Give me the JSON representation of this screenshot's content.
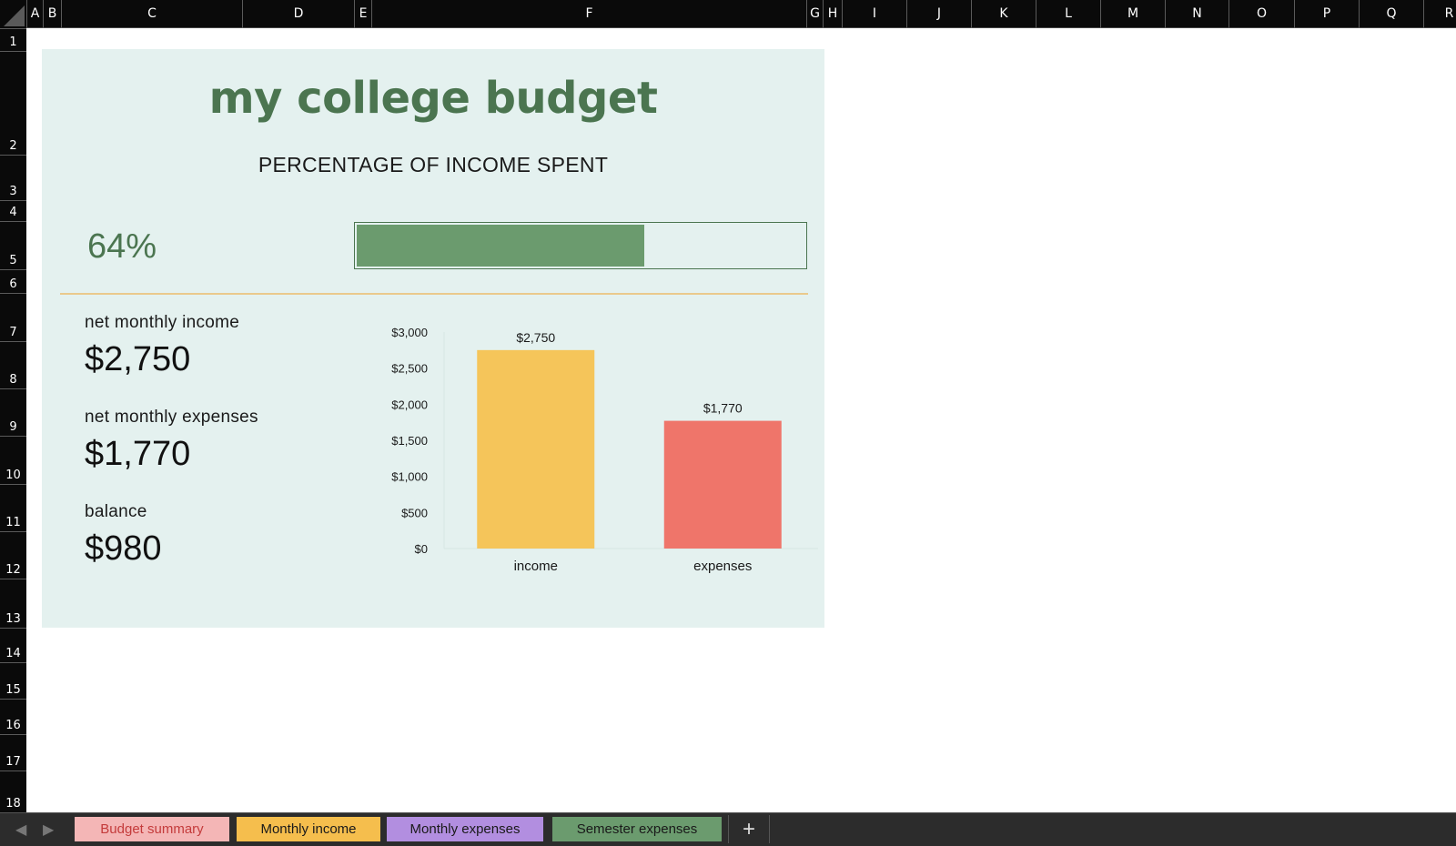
{
  "columns": [
    "A",
    "B",
    "C",
    "D",
    "E",
    "F",
    "G",
    "H",
    "I",
    "J",
    "K",
    "L",
    "M",
    "N",
    "O",
    "P",
    "Q",
    "R"
  ],
  "rows": [
    "1",
    "2",
    "3",
    "4",
    "5",
    "6",
    "7",
    "8",
    "9",
    "10",
    "11",
    "12",
    "13",
    "14",
    "15",
    "16",
    "17",
    "18"
  ],
  "dashboard": {
    "title": "my college budget",
    "subtitle": "PERCENTAGE OF INCOME SPENT",
    "percent_label": "64%",
    "percent_spent": 0.64,
    "stats": [
      {
        "label": "net monthly income",
        "value": "$2,750"
      },
      {
        "label": "net monthly expenses",
        "value": "$1,770"
      },
      {
        "label": "balance",
        "value": "$980"
      }
    ]
  },
  "chart_data": {
    "type": "bar",
    "categories": [
      "income",
      "expenses"
    ],
    "values": [
      2750,
      1770
    ],
    "data_labels": [
      "$2,750",
      "$1,770"
    ],
    "colors": [
      "#f5c55a",
      "#ef756a"
    ],
    "ylim": [
      0,
      3000
    ],
    "yticks": [
      0,
      500,
      1000,
      1500,
      2000,
      2500,
      3000
    ],
    "ytick_labels": [
      "$0",
      "$500",
      "$1,000",
      "$1,500",
      "$2,000",
      "$2,500",
      "$3,000"
    ],
    "title": "",
    "xlabel": "",
    "ylabel": "",
    "grid": false
  },
  "tabs": [
    {
      "label": "Budget summary",
      "color": "#f4b6b6",
      "text_color": "#c43b3b"
    },
    {
      "label": "Monthly income",
      "color": "#f5be4d",
      "text_color": "#1a1a1a"
    },
    {
      "label": "Monthly expenses",
      "color": "#b28ee0",
      "text_color": "#1a1a1a"
    },
    {
      "label": "Semester expenses",
      "color": "#6b9b6e",
      "text_color": "#1a1a1a"
    }
  ],
  "icons": {
    "prev": "chevron-left-icon",
    "next": "chevron-right-icon",
    "add": "plus-icon"
  },
  "add_tab_label": "+"
}
